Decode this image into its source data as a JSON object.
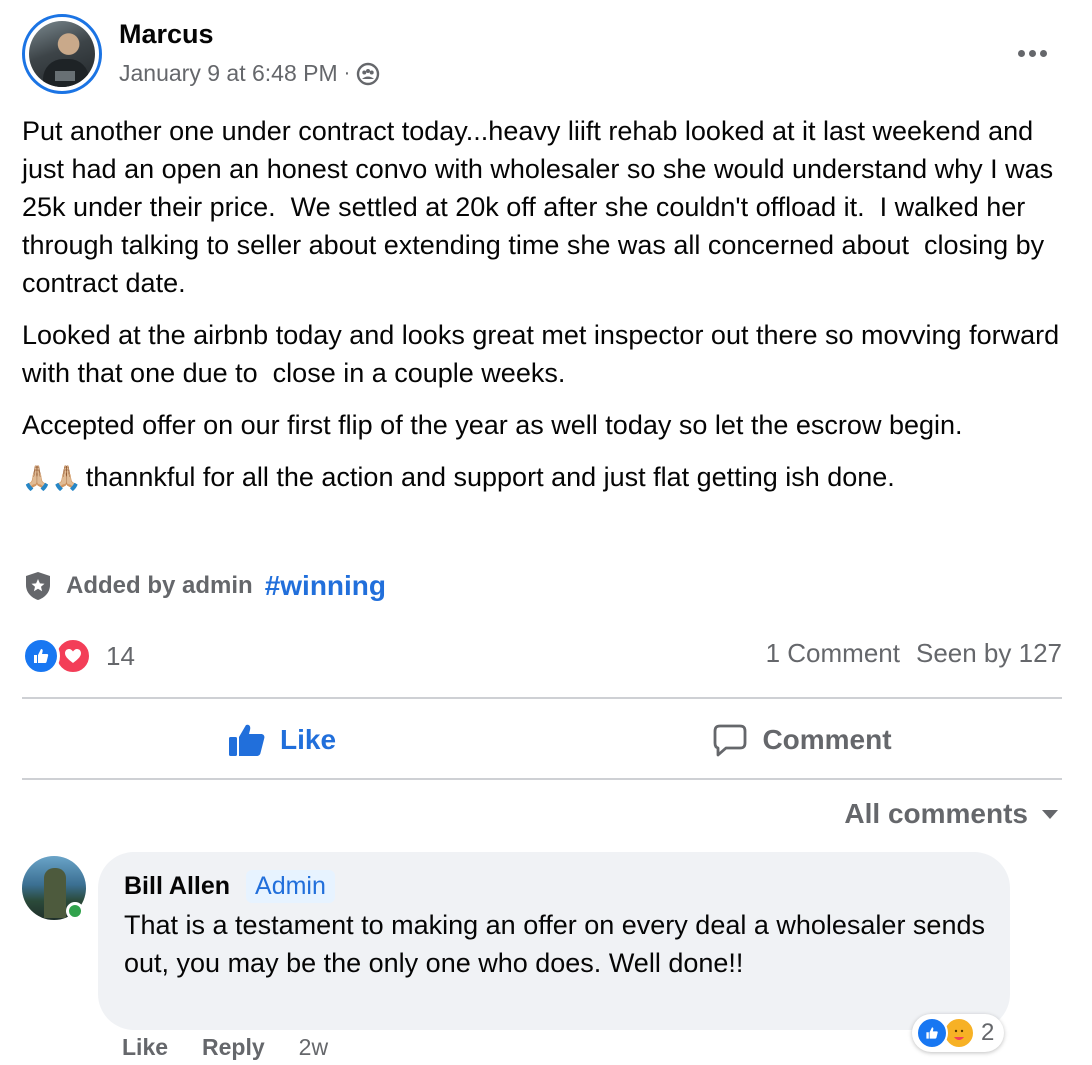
{
  "post": {
    "author": "Marcus",
    "timestamp": "January 9 at 6:48 PM",
    "separator": "·",
    "audience_icon": "group-audience-icon",
    "paragraphs": [
      "Put another one under contract today...heavy liift rehab looked at it last weekend and just had an open an honest convo with wholesaler so she would understand why I was 25k under their price.  We settled at 20k off after she couldn't offload it.  I walked her through talking to seller about extending time she was all concerned about  closing by contract date.",
      "Looked at the airbnb today and looks great met inspector out there so movving forward with that one due to  close in a couple weeks.",
      "Accepted offer on our first flip of the year as well today so let the escrow begin."
    ],
    "last_line_emoji": "🙏🏼🙏🏼",
    "last_line_text": "thannkful for all the action and support and just flat getting ish done.",
    "added_by": "Added by admin",
    "hashtag": "#winning"
  },
  "reactions": {
    "count": "14",
    "types": [
      "like",
      "love"
    ],
    "comments": "1 Comment",
    "seen": "Seen by 127"
  },
  "actions": {
    "like": "Like",
    "comment": "Comment"
  },
  "filter": {
    "label": "All comments"
  },
  "comment": {
    "name": "Bill Allen",
    "badge": "Admin",
    "text": "That is a testament to making an offer on every deal a wholesaler sends out, you may be the only one who does. Well done!!",
    "reaction_count": "2",
    "reaction_types": [
      "like",
      "care"
    ],
    "like": "Like",
    "reply": "Reply",
    "time": "2w"
  },
  "colors": {
    "accent": "#216fdb",
    "like_blue": "#1877f2",
    "love_red": "#f33e58",
    "online_green": "#31a24c",
    "muted": "#65676b"
  }
}
